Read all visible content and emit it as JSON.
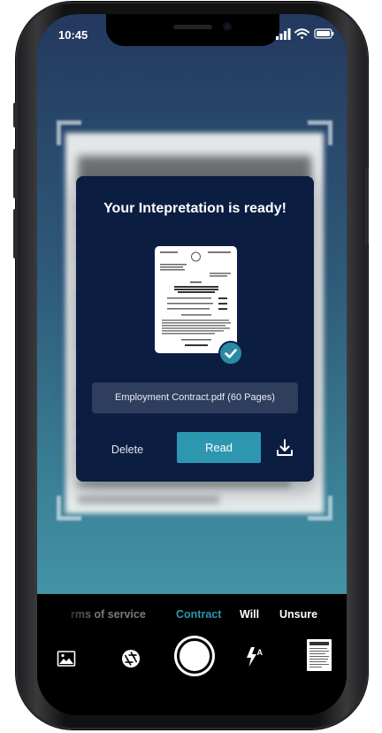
{
  "status_bar": {
    "time": "10:45",
    "icons": [
      "cellular-signal-icon",
      "wifi-icon",
      "battery-icon"
    ]
  },
  "modal": {
    "title": "Your Intepretation is ready!",
    "file_name": "Employment Contract.pdf (60 Pages)",
    "delete_label": "Delete",
    "read_label": "Read",
    "download_icon": "download-icon",
    "check_icon": "checkmark-icon"
  },
  "camera": {
    "modes": [
      {
        "label": "rms of service",
        "active": false
      },
      {
        "label": "Contract",
        "active": true
      },
      {
        "label": "Will",
        "active": false
      },
      {
        "label": "Unsure",
        "active": false
      }
    ],
    "toolbar_icons": [
      "gallery-icon",
      "aperture-icon",
      "shutter-button",
      "auto-flash-icon",
      "document-thumbnail"
    ]
  },
  "colors": {
    "accent": "#2d97b0",
    "modal_bg": "#0c1d42",
    "file_field_bg": "#2e3e5c",
    "camera_bg_top": "#24395f",
    "camera_bg_bottom": "#4393a7"
  }
}
